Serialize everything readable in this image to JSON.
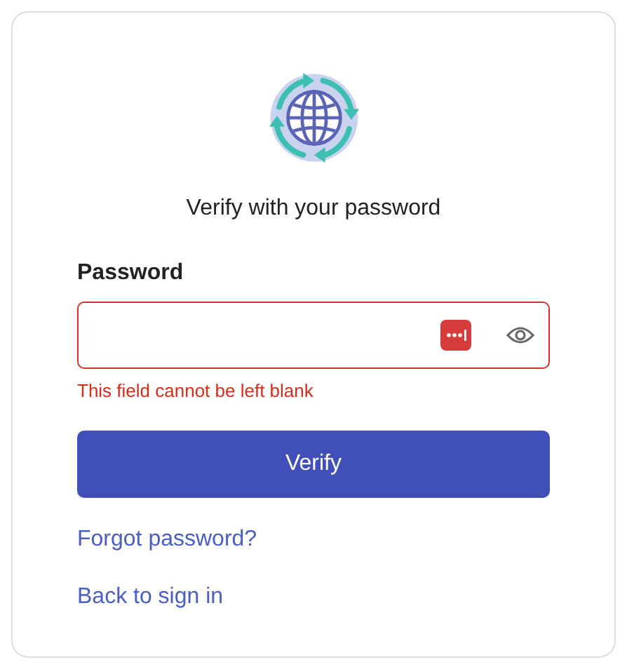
{
  "heading": "Verify with your password",
  "password": {
    "label": "Password",
    "error": true,
    "error_message": "This field cannot be left blank"
  },
  "verify_button": "Verify",
  "links": [
    "Forgot password?",
    "Back to sign in"
  ]
}
